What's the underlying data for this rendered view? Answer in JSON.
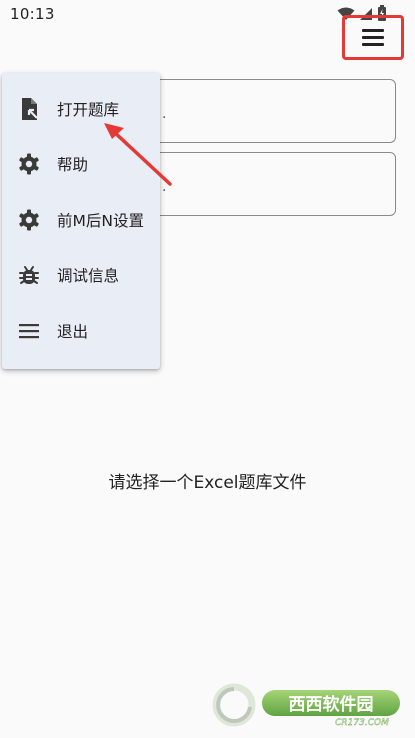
{
  "status_bar": {
    "time": "10:13",
    "icons": [
      "wifi-icon",
      "signal-icon",
      "battery-icon"
    ]
  },
  "toolbar": {
    "menu_icon": "hamburger-icon"
  },
  "menu": {
    "items": [
      {
        "label": "打开题库",
        "icon": "open-file-icon"
      },
      {
        "label": "帮助",
        "icon": "gear-icon"
      },
      {
        "label": "前M后N设置",
        "icon": "gear-icon"
      },
      {
        "label": "调试信息",
        "icon": "bug-icon"
      },
      {
        "label": "退出",
        "icon": "hamburger-icon"
      }
    ]
  },
  "main": {
    "field_1_text": ".",
    "field_2_text": ".",
    "empty_message": "请选择一个Excel题库文件"
  },
  "watermark": {
    "brand": "西西软件园",
    "site": "CR173.COM"
  },
  "colors": {
    "annotation": "#e53935",
    "menu_bg": "#e9edf6",
    "page_bg": "#fafafa",
    "icon": "#3a3a3a"
  }
}
